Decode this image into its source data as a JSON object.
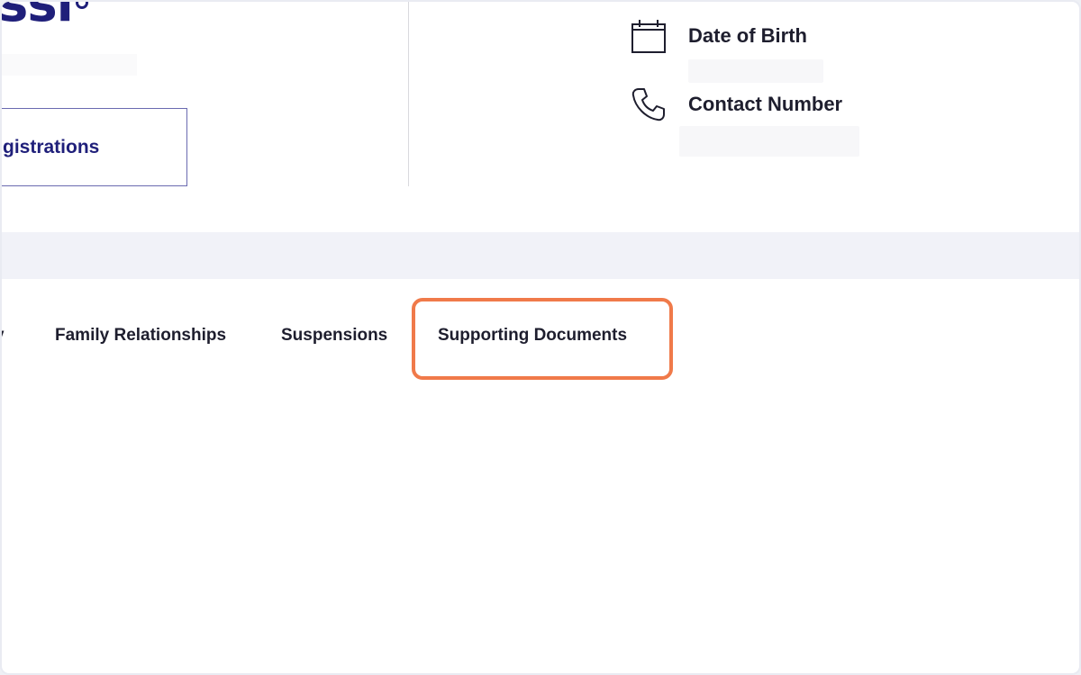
{
  "header": {
    "name_fragment": "ssi",
    "registrations_button": "gistrations",
    "dob_label": "Date of Birth",
    "contact_label": "Contact Number"
  },
  "icons": {
    "dob": "calendar-icon",
    "contact": "phone-icon"
  },
  "tabs": [
    {
      "label": "y"
    },
    {
      "label": "Family Relationships"
    },
    {
      "label": "Suspensions"
    },
    {
      "label": "Supporting Documents",
      "highlighted": true
    }
  ],
  "colors": {
    "brand_navy": "#1f1f7a",
    "text_dark": "#1e1e2e",
    "highlight": "#f07a4a",
    "band": "#f1f2f8"
  }
}
